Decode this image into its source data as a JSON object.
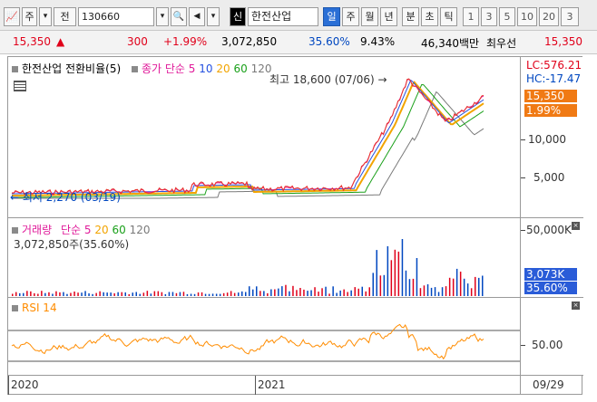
{
  "toolbar": {
    "buttons": [
      {
        "label": "📈",
        "name": "chart-type-icon"
      },
      {
        "label": "주",
        "name": "stock-type-select"
      },
      {
        "label": "▾",
        "name": "stock-type-dropdown-icon"
      },
      {
        "label": "전",
        "name": "market-select"
      },
      {
        "label": "130660",
        "name": "stock-code-input"
      },
      {
        "label": "▾",
        "name": "stock-code-dropdown-icon"
      },
      {
        "label": "🔍",
        "name": "search-icon"
      },
      {
        "label": "◀",
        "name": "prev-stock-icon"
      },
      {
        "label": "▾",
        "name": "stock-list-dropdown-icon"
      },
      {
        "label": "신",
        "name": "credit-badge"
      },
      {
        "label": "한전산업",
        "name": "stock-name-field"
      },
      {
        "label": "일",
        "name": "period-day-button"
      },
      {
        "label": "주",
        "name": "period-week-button"
      },
      {
        "label": "월",
        "name": "period-month-button"
      },
      {
        "label": "년",
        "name": "period-year-button"
      },
      {
        "label": "분",
        "name": "period-minute-button"
      },
      {
        "label": "초",
        "name": "period-second-button"
      },
      {
        "label": "틱",
        "name": "period-tick-button"
      },
      {
        "label": "1",
        "name": "interval-1-button"
      },
      {
        "label": "3",
        "name": "interval-3-button"
      },
      {
        "label": "5",
        "name": "interval-5-button"
      },
      {
        "label": "10",
        "name": "interval-10-button"
      },
      {
        "label": "20",
        "name": "interval-20-button"
      },
      {
        "label": "3",
        "name": "interval-30-button"
      }
    ]
  },
  "quote": {
    "price": "15,350",
    "arrow": "▲",
    "change": "300",
    "change_pct": "+1.99%",
    "volume": "3,072,850",
    "volume_ratio": "35.60%",
    "turnover": "9.43%",
    "amount": "46,340백만",
    "best_ask_label": "최우선",
    "best_ask": "15,350"
  },
  "price_pane": {
    "title": "한전산업 전환비율(5)",
    "ma_label": "종가 단순",
    "ma_periods": [
      "5",
      "10",
      "20",
      "60",
      "120"
    ],
    "lc": "LC:576.21",
    "hc": "HC:-17.47",
    "current": "15,350",
    "current_pct": "1.99%",
    "ticks": [
      "10,000",
      "5,000"
    ],
    "max_note": "최고 18,600 (07/06) →",
    "min_note": "← 최저 2,270 (03/19)"
  },
  "volume_pane": {
    "title": "거래량",
    "ma_label": "단순",
    "ma_periods": [
      "5",
      "20",
      "60",
      "120"
    ],
    "summary": "3,072,850주(35.60%)",
    "tick": "50,000K",
    "current": "3,073K",
    "current_pct": "35.60%"
  },
  "rsi_pane": {
    "title": "RSI 14",
    "tick": "50.00"
  },
  "dates": [
    "2020",
    "2021",
    "09/29"
  ],
  "colors": {
    "price_line": "#e8372a",
    "ma5": "#e01a9a",
    "ma10": "#2451e0",
    "ma20": "#f2a400",
    "ma60": "#1aa01a",
    "ma120": "#7a7a7a",
    "current_bg": "#f07a14",
    "volume_current_bg": "#2a5cd8",
    "rsi_line": "#ff8c00"
  }
}
